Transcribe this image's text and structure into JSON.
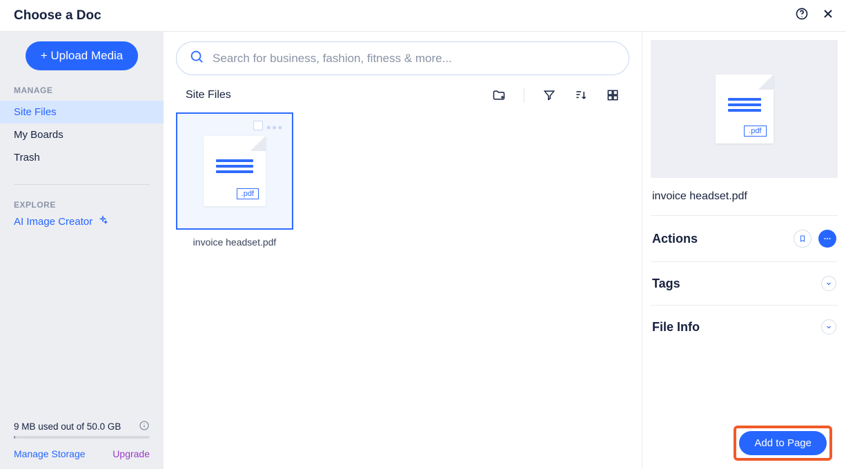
{
  "header": {
    "title": "Choose a Doc"
  },
  "sidebar": {
    "upload_label": "+ Upload Media",
    "manage_label": "MANAGE",
    "items": [
      {
        "label": "Site Files",
        "active": true
      },
      {
        "label": "My Boards",
        "active": false
      },
      {
        "label": "Trash",
        "active": false
      }
    ],
    "explore_label": "EXPLORE",
    "ai_label": "AI Image Creator",
    "storage_text": "9 MB used out of 50.0 GB",
    "manage_storage": "Manage Storage",
    "upgrade": "Upgrade"
  },
  "search": {
    "placeholder": "Search for business, fashion, fitness & more..."
  },
  "toolbar": {
    "breadcrumb": "Site Files"
  },
  "files": [
    {
      "name": "invoice headset.pdf",
      "ext": ".pdf",
      "selected": true
    }
  ],
  "details": {
    "selected_name": "invoice headset.pdf",
    "ext": ".pdf",
    "actions_label": "Actions",
    "tags_label": "Tags",
    "fileinfo_label": "File Info"
  },
  "footer": {
    "add_label": "Add to Page"
  }
}
